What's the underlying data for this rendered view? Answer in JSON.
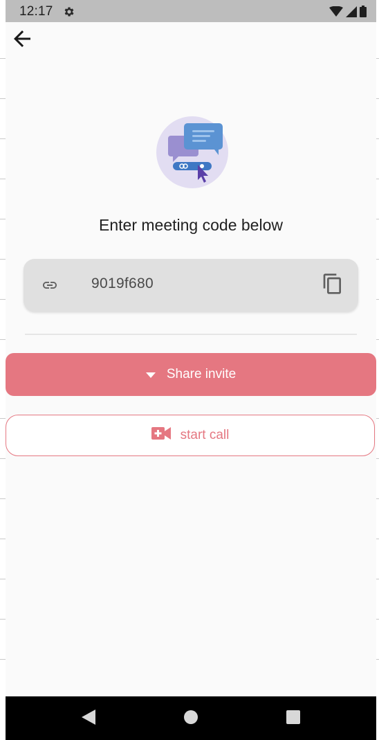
{
  "status_bar": {
    "time": "12:17",
    "icons": [
      "settings-gear-icon",
      "wifi-icon",
      "signal-icon",
      "battery-icon"
    ]
  },
  "toolbar": {
    "back_icon": "arrow-back-icon"
  },
  "hero": {
    "icon": "meeting-chat-illustration"
  },
  "title": "Enter meeting code below",
  "meeting_code": {
    "value": "9019f680",
    "leading_icon": "link-icon",
    "trailing_icon": "copy-icon"
  },
  "actions": {
    "share_label": "Share invite",
    "share_icon": "arrow-drop-down-icon",
    "start_call_label": "start call",
    "start_call_icon": "video-call-add-icon"
  },
  "nav_bar": {
    "buttons": [
      "back-triangle-icon",
      "home-circle-icon",
      "recents-square-icon"
    ]
  },
  "colors": {
    "accent": "#e57781",
    "status_bar": "#bdbdbd",
    "field_bg": "#e0e0e0",
    "background": "#fafafa",
    "nav_bar": "#000000"
  }
}
